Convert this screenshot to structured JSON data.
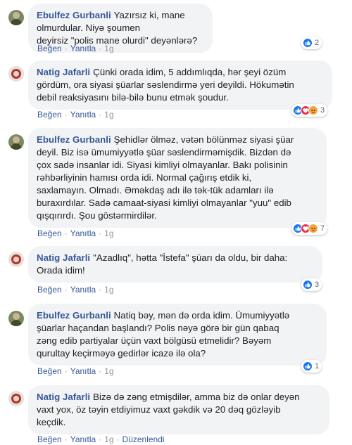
{
  "comments": [
    {
      "author": "Ebulfez Gurbanli",
      "text": "Yazırsız ki, mane olmurdular. Niyə şoumen\ndeyirsiz \"polis mane olurdi\" deyənlərə?",
      "like": "Beğen",
      "reply": "Yanıtla",
      "time": "1g",
      "reaction_count": "2",
      "reactions": [
        "like-icon"
      ],
      "edited": ""
    },
    {
      "author": "Natig Jafarli",
      "text": "Çünki orada idim, 5 addımlıqda, hər şeyi özüm\ngördüm, ora siyasi şüarlar səslendirmə yeri deyildi. Hökumətin\ndebil reaksiyasını bilə-bilə bunu etmək şoudur.",
      "like": "Beğen",
      "reply": "Yanıtla",
      "time": "1g",
      "reaction_count": "3",
      "reactions": [
        "like-icon",
        "love-icon",
        "angry-icon"
      ],
      "edited": ""
    },
    {
      "author": "Ebulfez Gurbanli",
      "text": "Şehidlər ölməz, vətən bölünməz siyasi şüar\ndeyil. Biz isə ümumiyyətlə şüar səslendirməmişdik. Bizdən də\nçox sadə insanlar idi. Siyasi kimliyi olmayanlar. Bakı polisinin\nrəhbərliyinin hamısı orda idi. Normal çağırış etdik ki,\nsaxlamayın. Olmadı. Əməkdaş adı ilə tək-tük adamları ilə\nburaxırdılar. Sadə camaat-siyasi kimliyi olmayanlar \"yuu\" edib\nqışqırırdı. Şou göstərmirdilər.",
      "like": "Beğen",
      "reply": "Yanıtla",
      "time": "1g",
      "reaction_count": "7",
      "reactions": [
        "like-icon",
        "love-icon",
        "angry-icon"
      ],
      "edited": ""
    },
    {
      "author": "Natig Jafarli",
      "text": "\"Azadlıq\", hətta \"İstefa\" şüarı da oldu, bir daha:\nOrada idim!",
      "like": "Beğen",
      "reply": "Yanıtla",
      "time": "1g",
      "reaction_count": "3",
      "reactions": [
        "like-icon"
      ],
      "edited": ""
    },
    {
      "author": "Ebulfez Gurbanli",
      "text": "Natiq bəy, mən də orda idim. Ümumiyyətlə\nşüarlar haçandan başlandı? Polis nəyə görə bir gün qabaq\nzəng edib partiyalar üçün vaxt bölgüsü etmelidir? Bəyəm\nqurultay keçirməyə gedirlər icazə ilə ola?",
      "like": "Beğen",
      "reply": "Yanıtla",
      "time": "1g",
      "reaction_count": "1",
      "reactions": [
        "like-icon"
      ],
      "edited": ""
    },
    {
      "author": "Natig Jafarli",
      "text": "Bizə də zəng etmişdilər, amma biz də onlar deyən\nvaxt yox, öz təyin etdiyimuz vaxt gəkdik və 20 dəq gözləyib\nkeçdik.",
      "like": "Beğen",
      "reply": "Yanıtla",
      "time": "1g",
      "reaction_count": "",
      "reactions": [],
      "edited": "Düzenlendi"
    }
  ]
}
